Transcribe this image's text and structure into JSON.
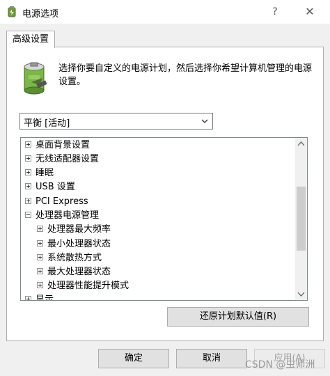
{
  "window": {
    "title": "电源选项",
    "help_label": "?",
    "close_label": "✕"
  },
  "tab": {
    "label": "高级设置"
  },
  "description": "选择你要自定义的电源计划，然后选择你希望计算机管理的电源设置。",
  "plan_select": {
    "value": "平衡 [活动]"
  },
  "tree": {
    "items": [
      {
        "label": "桌面背景设置",
        "level": 0,
        "expanded": false
      },
      {
        "label": "无线适配器设置",
        "level": 0,
        "expanded": false
      },
      {
        "label": "睡眠",
        "level": 0,
        "expanded": false
      },
      {
        "label": "USB 设置",
        "level": 0,
        "expanded": false
      },
      {
        "label": "PCI Express",
        "level": 0,
        "expanded": false
      },
      {
        "label": "处理器电源管理",
        "level": 0,
        "expanded": true
      },
      {
        "label": "处理器最大频率",
        "level": 1,
        "expanded": false
      },
      {
        "label": "最小处理器状态",
        "level": 1,
        "expanded": false
      },
      {
        "label": "系统散热方式",
        "level": 1,
        "expanded": false
      },
      {
        "label": "最大处理器状态",
        "level": 1,
        "expanded": false
      },
      {
        "label": "处理器性能提升模式",
        "level": 1,
        "expanded": false
      },
      {
        "label": "显示",
        "level": 0,
        "expanded": false
      }
    ]
  },
  "buttons": {
    "restore": "还原计划默认值(R)",
    "ok": "确定",
    "cancel": "取消",
    "apply": "应用(A)"
  },
  "watermark": "CSDN @虫师洲"
}
